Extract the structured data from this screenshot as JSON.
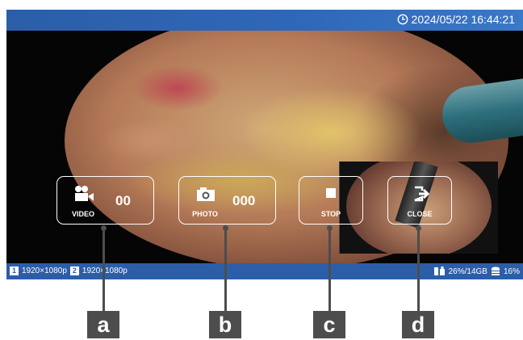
{
  "header": {
    "datetime": "2024/05/22 16:44:21"
  },
  "controls": {
    "video": {
      "label": "VIDEO",
      "count": "00"
    },
    "photo": {
      "label": "PHOTO",
      "count": "000"
    },
    "stop": {
      "label": "STOP"
    },
    "close": {
      "label": "CLOSE"
    }
  },
  "status": {
    "source1": {
      "num": "1",
      "res": "1920×1080p"
    },
    "source2": {
      "num": "2",
      "res": "1920×1080p"
    },
    "storage": "26%/14GB",
    "disk": "16%"
  },
  "callouts": [
    "a",
    "b",
    "c",
    "d"
  ],
  "colors": {
    "bar": "#2c5ea8",
    "callout": "#4d4d4d"
  }
}
